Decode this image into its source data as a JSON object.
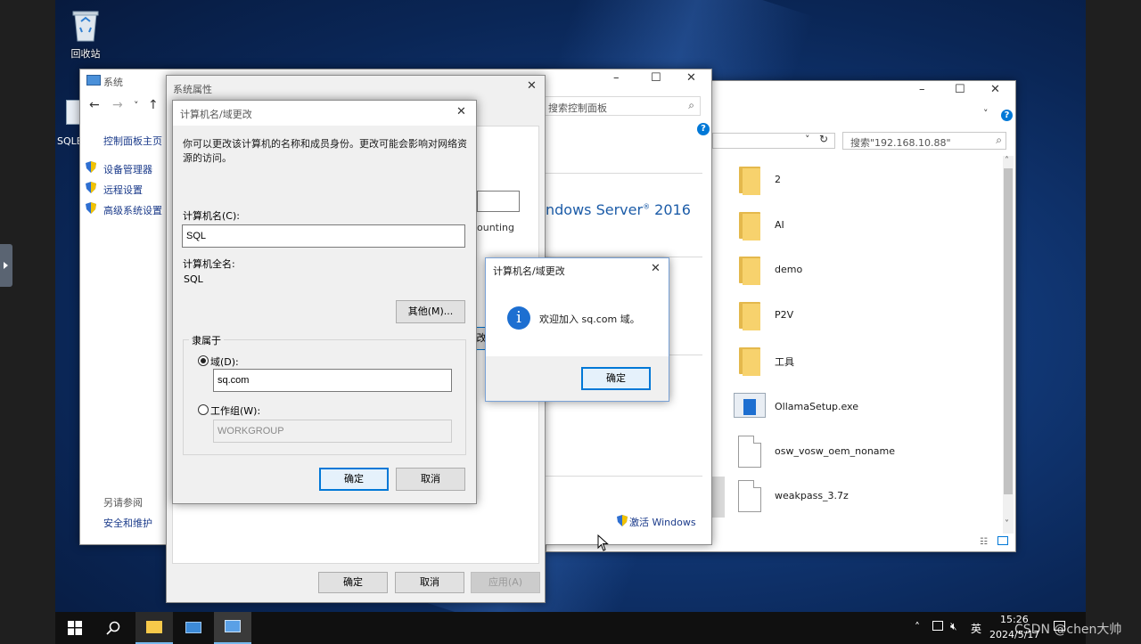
{
  "desktop": {
    "recycle_bin_label": "回收站",
    "sql_shortcut_label": "SQLE"
  },
  "system_window": {
    "title": "系统",
    "nav": {
      "back": "←",
      "forward": "→",
      "down": "˅",
      "up": "↑"
    },
    "search_placeholder": "搜索控制面板",
    "left_links": {
      "home": "控制面板主页",
      "device_manager": "设备管理器",
      "remote_settings": "远程设置",
      "advanced_settings": "高级系统设置"
    },
    "see_also": {
      "heading": "另请参阅",
      "security": "安全和维护"
    },
    "os_name": "ndows Server",
    "os_year": "2016",
    "partial_text": "ounting",
    "change_btn_partial": "改",
    "activate_text": "激活 Windows",
    "help": "?"
  },
  "explorer": {
    "search_placeholder": "搜索\"192.168.10.88\"",
    "help": "?",
    "items": [
      {
        "name": "2",
        "type": "folder"
      },
      {
        "name": "AI",
        "type": "folder"
      },
      {
        "name": "demo",
        "type": "folder"
      },
      {
        "name": "P2V",
        "type": "folder"
      },
      {
        "name": "工具",
        "type": "folder"
      },
      {
        "name": "OllamaSetup.exe",
        "type": "exe"
      },
      {
        "name": "osw_vosw_oem_noname",
        "type": "file"
      },
      {
        "name": "weakpass_3.7z",
        "type": "file"
      }
    ]
  },
  "system_properties": {
    "title": "系统属性",
    "ok": "确定",
    "cancel": "取消",
    "apply": "应用(A)"
  },
  "name_change": {
    "title": "计算机名/域更改",
    "description": "你可以更改该计算机的名称和成员身份。更改可能会影响对网络资源的访问。",
    "computer_name_label": "计算机名(C):",
    "computer_name_value": "SQL",
    "full_name_label": "计算机全名:",
    "full_name_value": "SQL",
    "other_button": "其他(M)...",
    "member_of_label": "隶属于",
    "domain_label": "域(D):",
    "domain_value": "sq.com",
    "workgroup_label": "工作组(W):",
    "workgroup_value": "WORKGROUP",
    "ok": "确定",
    "cancel": "取消"
  },
  "welcome_dialog": {
    "title": "计算机名/域更改",
    "message": "欢迎加入 sq.com 域。",
    "ok": "确定"
  },
  "taskbar": {
    "ime": "英",
    "time": "15:26",
    "date": "2024/5/17",
    "watermark": "CSDN @chen大帅"
  },
  "colors": {
    "accent": "#0078d7",
    "taskbar": "#101010",
    "folder": "#f7d26d"
  }
}
